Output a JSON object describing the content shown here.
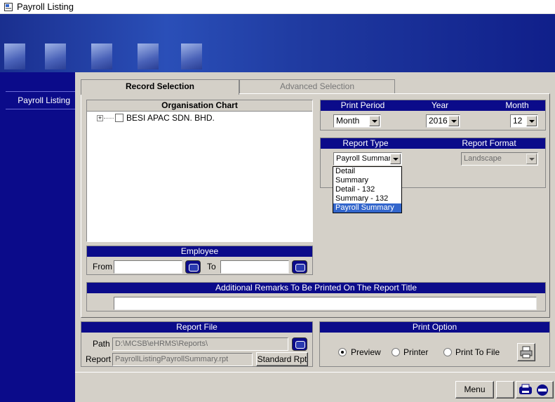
{
  "window": {
    "title": "Payroll Listing"
  },
  "sidebar": {
    "items": [
      {
        "label": "Payroll Listing"
      }
    ]
  },
  "tabs": [
    {
      "label": "Record Selection"
    },
    {
      "label": "Advanced Selection"
    }
  ],
  "org_chart": {
    "header": "Organisation Chart",
    "node": {
      "expander": "+",
      "label": "BESI APAC SDN. BHD."
    }
  },
  "period": {
    "print_period_label": "Print Period",
    "print_period_value": "Month",
    "year_label": "Year",
    "year_value": "2016",
    "month_label": "Month",
    "month_value": "12"
  },
  "report": {
    "type_label": "Report Type",
    "type_value": "Payroll Summary",
    "format_label": "Report Format",
    "format_value": "Landscape",
    "type_options": [
      "Detail",
      "Summary",
      "Detail - 132",
      "Summary - 132",
      "Payroll Summary"
    ],
    "selected_option": "Payroll Summary"
  },
  "employee": {
    "header": "Employee",
    "from_label": "From",
    "from_value": "",
    "to_label": "To",
    "to_value": ""
  },
  "remarks": {
    "header": "Additional Remarks To Be Printed On The Report Title",
    "value": ""
  },
  "report_file": {
    "header": "Report File",
    "path_label": "Path",
    "path_value": "D:\\MCSB\\eHRMS\\Reports\\",
    "report_label": "Report",
    "report_value": "PayrollListingPayrollSummary.rpt",
    "standard_button": "Standard Rpt"
  },
  "print_option": {
    "header": "Print Option",
    "options": [
      "Preview",
      "Printer",
      "Print To File"
    ],
    "selected": "Preview"
  },
  "footer": {
    "menu_button": "Menu"
  },
  "colors": {
    "navy": "#0b0b8a",
    "face": "#d4d0c8",
    "selection": "#3366cc"
  }
}
